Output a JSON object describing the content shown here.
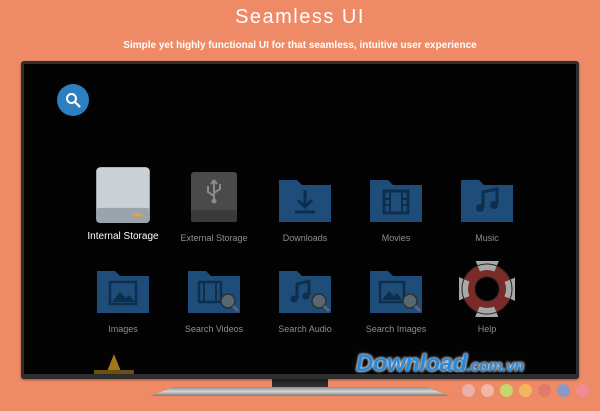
{
  "banner": {
    "title": "Seamless UI",
    "subtitle": "Simple yet highly functional UI for that seamless, intuitive user experience"
  },
  "screen": {
    "search_icon": "search-icon",
    "tiles": [
      {
        "label": "Internal Storage",
        "icon": "internal-storage-icon",
        "active": true
      },
      {
        "label": "External Storage",
        "icon": "usb-drive-icon"
      },
      {
        "label": "Downloads",
        "icon": "download-folder-icon"
      },
      {
        "label": "Movies",
        "icon": "movie-folder-icon"
      },
      {
        "label": "Music",
        "icon": "music-folder-icon"
      },
      {
        "label": "Images",
        "icon": "image-folder-icon"
      },
      {
        "label": "Search Videos",
        "icon": "search-videos-icon"
      },
      {
        "label": "Search Audio",
        "icon": "search-audio-icon"
      },
      {
        "label": "Search Images",
        "icon": "search-images-icon"
      },
      {
        "label": "Help",
        "icon": "lifebuoy-icon"
      }
    ]
  },
  "watermark": {
    "main": "Download",
    "suffix": ".com.vn"
  },
  "colors": {
    "background": "#ef8a66",
    "accent": "#2c7fc0",
    "folder": "#1e4d7a",
    "dots": [
      "#e8b0a6",
      "#f2b6a4",
      "#c8d66e",
      "#f4b65a",
      "#e27a6a",
      "#8a98c8",
      "#f08a98"
    ]
  }
}
